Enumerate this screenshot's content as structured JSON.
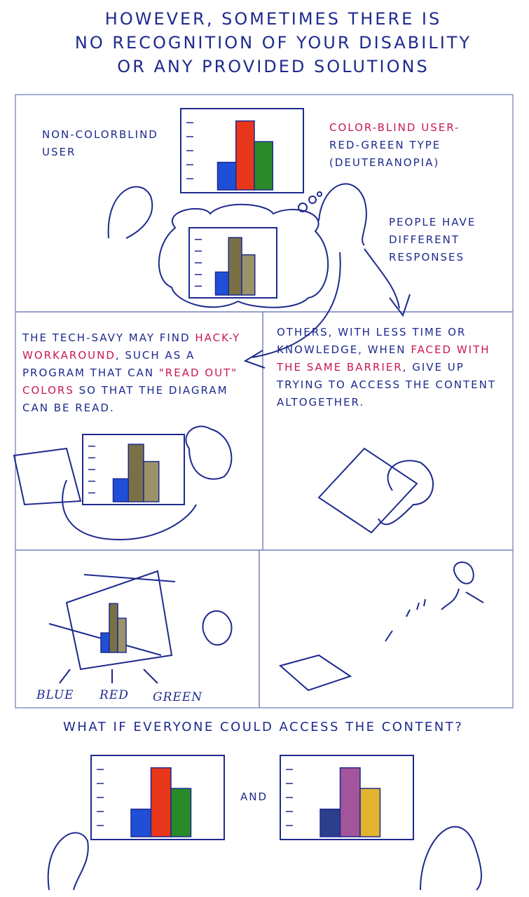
{
  "title": {
    "line1": "HOWEVER, SOMETIMES THERE IS",
    "line2": "NO RECOGNITION OF YOUR DISABILITY",
    "line3": "OR ANY PROVIDED SOLUTIONS"
  },
  "panel1": {
    "non_colorblind_label": "NON-COLORBLIND USER",
    "colorblind_label": "COLOR-BLIND USER-",
    "colorblind_type": "RED-GREEN TYPE (DEUTERANOPIA)",
    "responses": "PEOPLE HAVE DIFFERENT RESPONSES"
  },
  "panel2": {
    "text_a": "THE TECH-SAVY MAY FIND",
    "highlight": "HACK-Y WORKAROUND",
    "text_b": ", SUCH AS A PROGRAM THAT CAN",
    "highlight2": "\"READ OUT\" COLORS",
    "text_c": "SO THAT THE DIAGRAM CAN BE READ."
  },
  "panel3": {
    "text_a": "OTHERS, WITH LESS TIME OR KNOWLEDGE, WHEN",
    "highlight": "FACED WITH THE SAME BARRIER",
    "text_b": ", GIVE UP TRYING TO ACCESS THE CONTENT ALTOGETHER."
  },
  "panel4": {
    "labels": [
      "BLUE",
      "RED",
      "GREEN"
    ]
  },
  "bottom": {
    "question": "WHAT IF EVERYONE COULD ACCESS THE CONTENT?",
    "and": "AND"
  },
  "colors": {
    "ink": "#1e2a8e",
    "highlight": "#c8194f",
    "blue": "#1f4fd6",
    "red": "#e8361a",
    "green": "#2a8a2a",
    "olive_dark": "#7a7046",
    "olive_light": "#9c9268",
    "alt_blue": "#2c3f8c",
    "alt_purple": "#a2559a",
    "alt_yellow": "#e2b430"
  },
  "chart_values": [
    0.4,
    1.0,
    0.7
  ]
}
